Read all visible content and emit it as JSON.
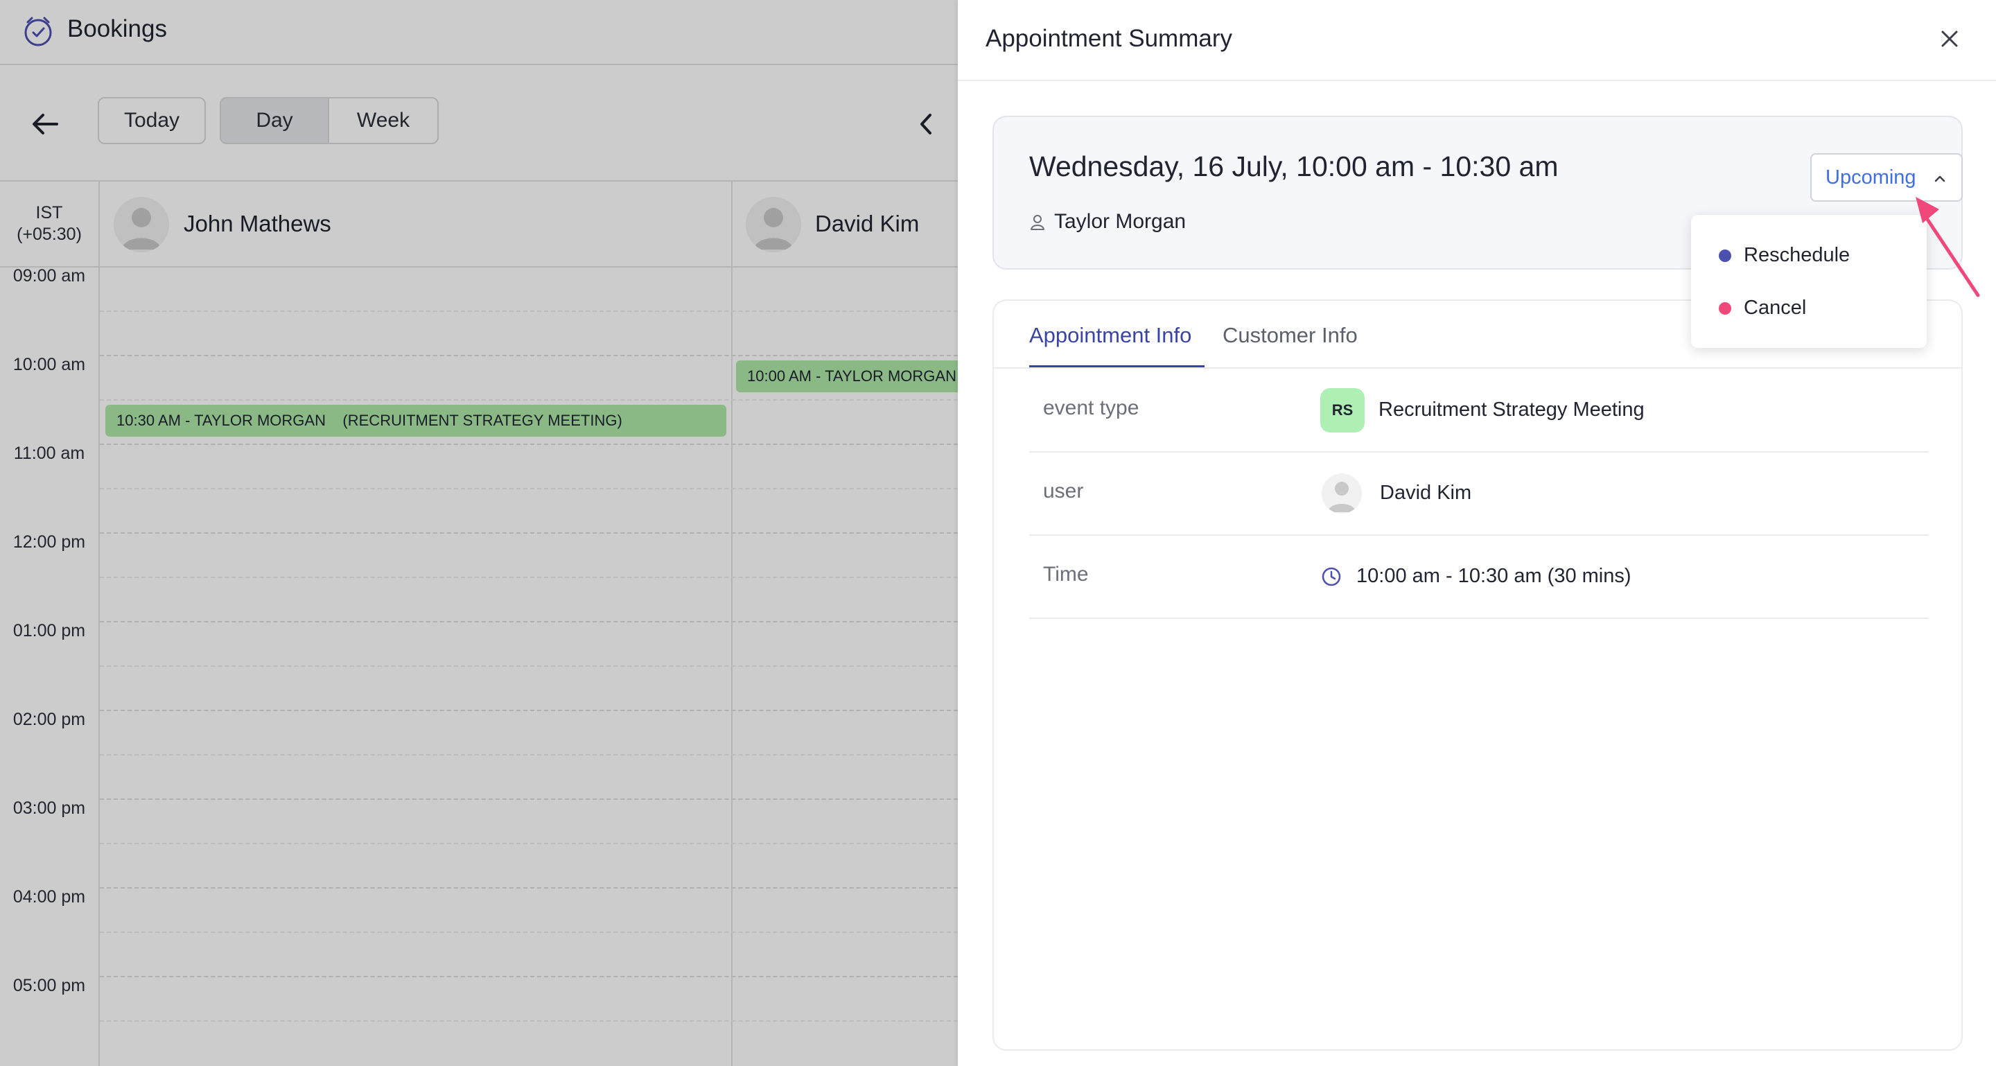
{
  "app": {
    "title": "Bookings",
    "icon": "calendar-clock-icon"
  },
  "toolbar": {
    "today_label": "Today",
    "day_label": "Day",
    "week_label": "Week",
    "selected_view": "Day"
  },
  "calendar": {
    "timezone_line1": "IST",
    "timezone_line2": "(+05:30)",
    "staff": [
      {
        "name": "John Mathews"
      },
      {
        "name": "David Kim"
      }
    ],
    "times": [
      "09:00 am",
      "10:00 am",
      "11:00 am",
      "12:00 pm",
      "01:00 pm",
      "02:00 pm",
      "03:00 pm",
      "04:00 pm",
      "05:00 pm"
    ],
    "events": [
      {
        "staff": "John Mathews",
        "label": "10:30 AM - TAYLOR MORGAN    (RECRUITMENT STRATEGY MEETING)",
        "color": "#aee8a8"
      },
      {
        "staff": "David Kim",
        "label": "10:00 AM - TAYLOR MORGAN",
        "color": "#aee8a8"
      }
    ]
  },
  "panel": {
    "title": "Appointment Summary",
    "summary": {
      "datetime": "Wednesday, 16 July, 10:00 am - 10:30 am",
      "customer": "Taylor Morgan",
      "status": "Upcoming",
      "status_color": "#3f6ee0"
    },
    "status_menu": [
      {
        "label": "Reschedule",
        "dot_color": "#4a4fb0"
      },
      {
        "label": "Cancel",
        "dot_color": "#f0487a"
      }
    ],
    "tabs": [
      {
        "label": "Appointment Info",
        "active": true
      },
      {
        "label": "Customer Info",
        "active": false
      }
    ],
    "info": {
      "event_type_label": "event type",
      "event_type_badge": "RS",
      "event_type_value": "Recruitment Strategy Meeting",
      "user_label": "user",
      "user_value": "David Kim",
      "time_label": "Time",
      "time_value": "10:00 am - 10:30 am (30 mins)"
    },
    "accent_color": "#3a44a6"
  }
}
